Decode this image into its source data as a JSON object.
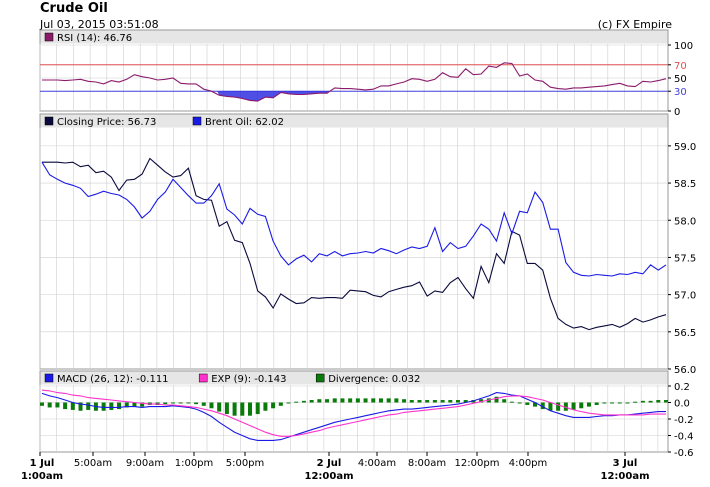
{
  "header": {
    "title": "Crude Oil",
    "datetime": "Jul 03, 2015 03:51:08",
    "copyright": "(c) FX Empire"
  },
  "colors": {
    "rsi": "#8b1a6b",
    "rsi_upper": "#e05050",
    "rsi_lower": "#4040e0",
    "rsi_fill": "#3030e0",
    "closing": "#0a0a3c",
    "brent": "#1a1ae6",
    "macd": "#1a1ae6",
    "exp": "#ff33cc",
    "divergence": "#0a7a0a",
    "grid": "#cfcfcf",
    "panel_header": "#e6e6e6"
  },
  "x_axis": {
    "ticks": [
      {
        "line1": "1 Jul",
        "line2": "1:00am",
        "major": true
      },
      {
        "line1": "5:00am",
        "line2": "",
        "major": false
      },
      {
        "line1": "9:00am",
        "line2": "",
        "major": false
      },
      {
        "line1": "1:00pm",
        "line2": "",
        "major": false
      },
      {
        "line1": "5:00pm",
        "line2": "",
        "major": false
      },
      {
        "line1": "2 Jul",
        "line2": "12:00am",
        "major": true
      },
      {
        "line1": "4:00am",
        "line2": "",
        "major": false
      },
      {
        "line1": "8:00am",
        "line2": "",
        "major": false
      },
      {
        "line1": "12:00pm",
        "line2": "",
        "major": false
      },
      {
        "line1": "4:00pm",
        "line2": "",
        "major": false
      },
      {
        "line1": "3 Jul",
        "line2": "12:00am",
        "major": true
      }
    ]
  },
  "chart_data": [
    {
      "type": "line",
      "panel": "rsi",
      "legend": [
        {
          "label": "RSI (14): 46.76",
          "color": "#8b1a6b"
        }
      ],
      "y_ticks": [
        100,
        70,
        50,
        30,
        0
      ],
      "ylim": [
        0,
        100
      ],
      "levels": [
        70,
        30
      ],
      "series": [
        {
          "name": "RSI (14)",
          "values": [
            47,
            47,
            47,
            46,
            47,
            48,
            45,
            44,
            41,
            46,
            44,
            48,
            55,
            52,
            50,
            47,
            48,
            50,
            42,
            41,
            41,
            33,
            30,
            24,
            22,
            21,
            19,
            16,
            15,
            21,
            20,
            28,
            26,
            25,
            25,
            26,
            27,
            27,
            35,
            34,
            34,
            33,
            32,
            33,
            38,
            38,
            41,
            44,
            49,
            48,
            45,
            48,
            58,
            52,
            51,
            64,
            55,
            56,
            68,
            66,
            73,
            72,
            53,
            56,
            47,
            45,
            36,
            34,
            33,
            35,
            35,
            36,
            37,
            38,
            40,
            42,
            38,
            37,
            45,
            44,
            46,
            49
          ]
        }
      ]
    },
    {
      "type": "line",
      "panel": "price",
      "legend": [
        {
          "label": "Closing Price: 56.73",
          "color": "#0a0a3c"
        },
        {
          "label": "Brent Oil: 62.02",
          "color": "#1a1ae6"
        }
      ],
      "y_ticks": [
        59.0,
        58.5,
        58.0,
        57.5,
        57.0,
        56.5,
        56.0
      ],
      "ylim": [
        56.0,
        59.2
      ],
      "series": [
        {
          "name": "Closing Price",
          "values": [
            58.78,
            58.78,
            58.78,
            58.77,
            58.78,
            58.72,
            58.74,
            58.64,
            58.66,
            58.58,
            58.4,
            58.54,
            58.55,
            58.62,
            58.83,
            58.74,
            58.65,
            58.58,
            58.6,
            58.7,
            58.33,
            58.28,
            58.27,
            57.92,
            57.98,
            57.73,
            57.7,
            57.42,
            57.05,
            56.97,
            56.82,
            57.01,
            56.94,
            56.88,
            56.89,
            56.96,
            56.95,
            56.96,
            56.96,
            56.95,
            57.06,
            57.05,
            57.04,
            56.99,
            56.97,
            57.04,
            57.07,
            57.1,
            57.12,
            57.17,
            56.98,
            57.05,
            57.03,
            57.16,
            57.23,
            57.08,
            56.95,
            57.38,
            57.16,
            57.55,
            57.42,
            57.85,
            57.8,
            57.42,
            57.42,
            57.33,
            56.95,
            56.68,
            56.6,
            56.55,
            56.57,
            56.53,
            56.56,
            56.58,
            56.6,
            56.56,
            56.61,
            56.68,
            56.63,
            56.66,
            56.7,
            56.73
          ]
        },
        {
          "name": "Brent Oil",
          "values": [
            58.78,
            58.61,
            58.55,
            58.5,
            58.47,
            58.43,
            58.32,
            58.35,
            58.39,
            58.36,
            58.34,
            58.28,
            58.18,
            58.03,
            58.12,
            58.28,
            58.38,
            58.55,
            58.44,
            58.33,
            58.23,
            58.23,
            58.33,
            58.49,
            58.15,
            58.07,
            57.95,
            58.16,
            58.08,
            58.05,
            57.72,
            57.52,
            57.4,
            57.48,
            57.53,
            57.44,
            57.55,
            57.52,
            57.58,
            57.52,
            57.55,
            57.56,
            57.58,
            57.56,
            57.62,
            57.59,
            57.55,
            57.6,
            57.64,
            57.62,
            57.65,
            57.9,
            57.58,
            57.7,
            57.62,
            57.65,
            57.79,
            57.95,
            57.88,
            57.72,
            58.1,
            57.82,
            58.12,
            58.1,
            58.38,
            58.24,
            57.88,
            57.88,
            57.43,
            57.3,
            57.26,
            57.25,
            57.27,
            57.26,
            57.25,
            57.28,
            57.27,
            57.3,
            57.28,
            57.4,
            57.33,
            57.4
          ]
        }
      ]
    },
    {
      "type": "line",
      "panel": "macd",
      "legend": [
        {
          "label": "MACD (26, 12): -0.111",
          "color": "#1a1ae6"
        },
        {
          "label": "EXP (9): -0.143",
          "color": "#ff33cc"
        },
        {
          "label": "Divergence: 0.032",
          "color": "#0a7a0a"
        }
      ],
      "y_ticks": [
        0.2,
        0.0,
        -0.2,
        -0.4,
        -0.6
      ],
      "ylim": [
        -0.6,
        0.2
      ],
      "series": [
        {
          "name": "MACD (26, 12)",
          "values": [
            0.11,
            0.08,
            0.06,
            0.03,
            0.0,
            -0.02,
            -0.03,
            -0.05,
            -0.06,
            -0.06,
            -0.06,
            -0.05,
            -0.05,
            -0.06,
            -0.05,
            -0.05,
            -0.05,
            -0.04,
            -0.05,
            -0.06,
            -0.08,
            -0.12,
            -0.17,
            -0.24,
            -0.3,
            -0.36,
            -0.4,
            -0.44,
            -0.46,
            -0.46,
            -0.46,
            -0.45,
            -0.42,
            -0.39,
            -0.36,
            -0.33,
            -0.3,
            -0.27,
            -0.24,
            -0.22,
            -0.2,
            -0.18,
            -0.16,
            -0.14,
            -0.12,
            -0.1,
            -0.09,
            -0.08,
            -0.08,
            -0.07,
            -0.06,
            -0.05,
            -0.04,
            -0.03,
            -0.02,
            0.0,
            0.02,
            0.05,
            0.08,
            0.12,
            0.11,
            0.09,
            0.08,
            0.04,
            0.0,
            -0.05,
            -0.1,
            -0.13,
            -0.16,
            -0.18,
            -0.18,
            -0.18,
            -0.17,
            -0.16,
            -0.16,
            -0.15,
            -0.15,
            -0.14,
            -0.13,
            -0.12,
            -0.11,
            -0.11
          ]
        },
        {
          "name": "EXP (9)",
          "values": [
            0.15,
            0.14,
            0.12,
            0.11,
            0.09,
            0.08,
            0.06,
            0.05,
            0.04,
            0.03,
            0.02,
            0.01,
            0.0,
            -0.01,
            -0.02,
            -0.02,
            -0.03,
            -0.03,
            -0.04,
            -0.05,
            -0.06,
            -0.08,
            -0.1,
            -0.13,
            -0.16,
            -0.2,
            -0.24,
            -0.28,
            -0.32,
            -0.36,
            -0.39,
            -0.41,
            -0.41,
            -0.4,
            -0.38,
            -0.36,
            -0.34,
            -0.31,
            -0.29,
            -0.27,
            -0.25,
            -0.23,
            -0.21,
            -0.19,
            -0.17,
            -0.15,
            -0.14,
            -0.12,
            -0.11,
            -0.1,
            -0.09,
            -0.08,
            -0.07,
            -0.06,
            -0.05,
            -0.03,
            -0.01,
            0.01,
            0.03,
            0.05,
            0.07,
            0.08,
            0.08,
            0.07,
            0.05,
            0.03,
            0.0,
            -0.03,
            -0.06,
            -0.09,
            -0.11,
            -0.13,
            -0.14,
            -0.15,
            -0.15,
            -0.15,
            -0.15,
            -0.15,
            -0.15,
            -0.14,
            -0.14,
            -0.14
          ]
        },
        {
          "name": "Divergence",
          "kind": "bar",
          "values": [
            -0.04,
            -0.06,
            -0.06,
            -0.08,
            -0.09,
            -0.1,
            -0.09,
            -0.1,
            -0.1,
            -0.09,
            -0.08,
            -0.06,
            -0.05,
            -0.05,
            -0.03,
            -0.03,
            -0.02,
            -0.01,
            -0.01,
            -0.01,
            -0.02,
            -0.04,
            -0.07,
            -0.11,
            -0.14,
            -0.16,
            -0.16,
            -0.16,
            -0.14,
            -0.1,
            -0.07,
            -0.04,
            -0.01,
            0.01,
            0.02,
            0.03,
            0.04,
            0.04,
            0.05,
            0.05,
            0.05,
            0.05,
            0.05,
            0.05,
            0.05,
            0.05,
            0.05,
            0.04,
            0.03,
            0.03,
            0.03,
            0.03,
            0.03,
            0.03,
            0.03,
            0.03,
            0.03,
            0.04,
            0.05,
            0.07,
            0.04,
            0.01,
            0.0,
            -0.03,
            -0.05,
            -0.08,
            -0.1,
            -0.1,
            -0.1,
            -0.09,
            -0.07,
            -0.05,
            -0.03,
            -0.01,
            -0.01,
            0.0,
            0.0,
            0.01,
            0.02,
            0.02,
            0.03,
            0.03
          ]
        }
      ]
    }
  ]
}
